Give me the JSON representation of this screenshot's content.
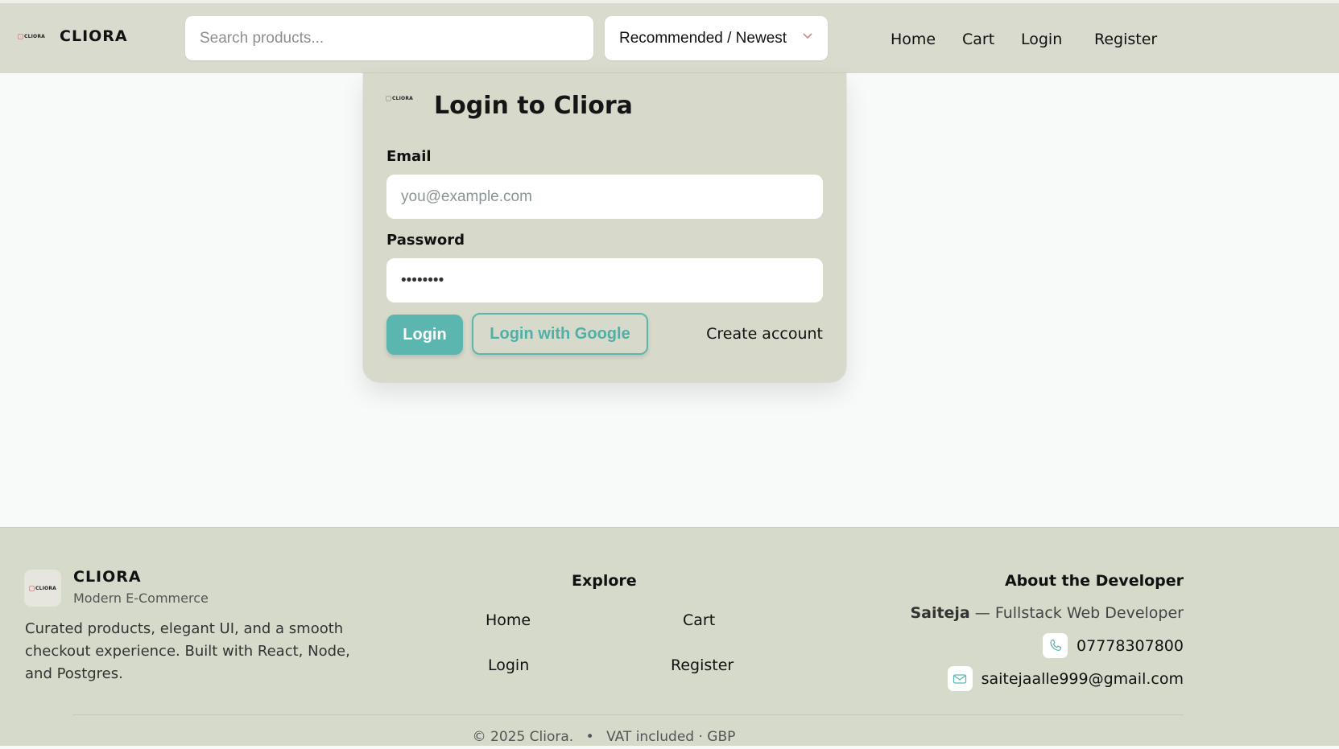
{
  "header": {
    "logo_text": "CLIORA",
    "brand": "CLIORA",
    "search_placeholder": "Search products...",
    "sort_label": "Recommended / Newest",
    "nav": [
      "Home",
      "Cart",
      "Login",
      "Register"
    ]
  },
  "login": {
    "logo_text": "CLIORA",
    "title": "Login to Cliora",
    "email_label": "Email",
    "email_placeholder": "you@example.com",
    "password_label": "Password",
    "password_value": "••••••••",
    "login_button": "Login",
    "google_button": "Login with Google",
    "create_account": "Create account"
  },
  "footer": {
    "logo_text": "CLIORA",
    "brand": "CLIORA",
    "tagline": "Modern E-Commerce",
    "description": "Curated products, elegant UI, and a smooth checkout experience. Built with React, Node, and Postgres.",
    "explore_title": "Explore",
    "explore_links": [
      "Home",
      "Cart",
      "Login",
      "Register"
    ],
    "about_title": "About the Developer",
    "developer_name": "Saiteja",
    "developer_role": " — Fullstack Web Developer",
    "phone": "07778307800",
    "email": "saitejaalle999@gmail.com",
    "copyright": "© 2025 Cliora.",
    "separator": "•",
    "vat_note": "VAT included · GBP"
  },
  "colors": {
    "header_bg": "#d8dbcd",
    "accent": "#5ab6ae",
    "page_bg": "#f8fafa"
  }
}
